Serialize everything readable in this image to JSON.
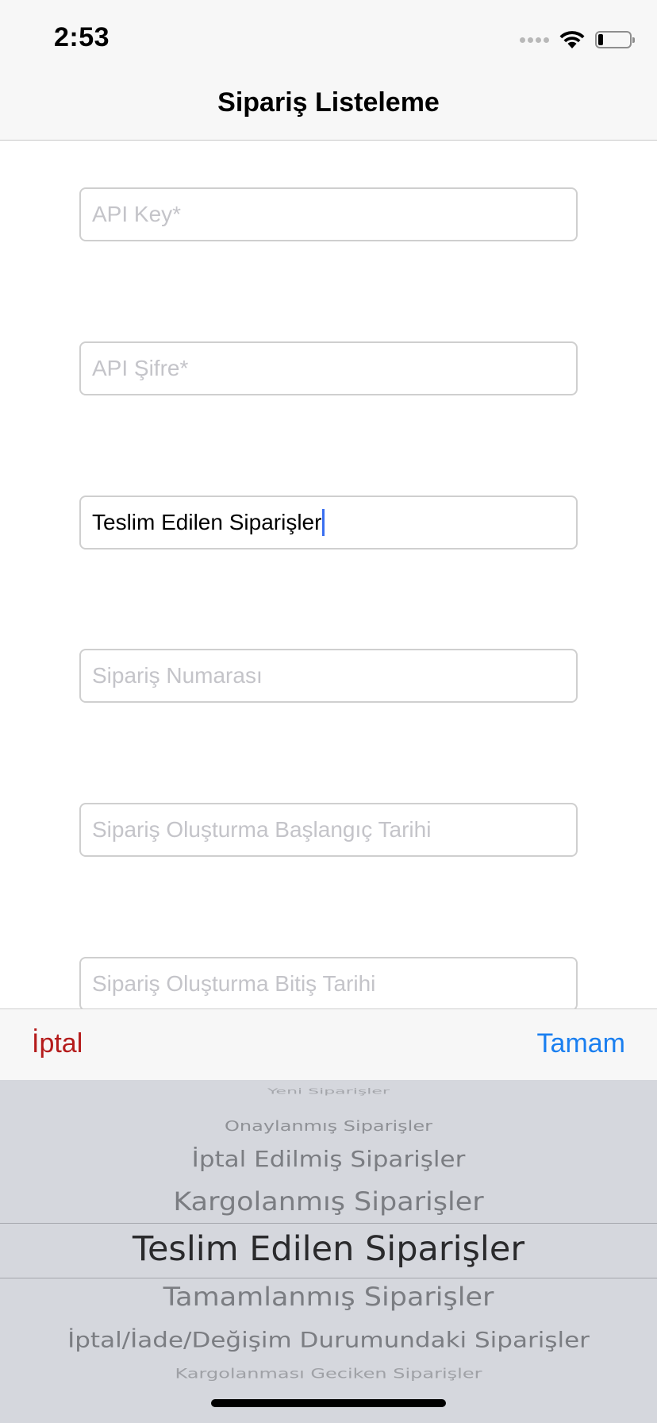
{
  "status_bar": {
    "time": "2:53",
    "icons": [
      "cellular-signal-icon",
      "wifi-icon",
      "battery-icon"
    ],
    "battery_level": 0.15
  },
  "nav_bar": {
    "title": "Sipariş Listeleme"
  },
  "form": {
    "api_key": {
      "placeholder": "API Key*",
      "value": ""
    },
    "api_password": {
      "placeholder": "API Şifre*",
      "value": ""
    },
    "order_status": {
      "placeholder": "",
      "value": "Teslim Edilen Siparişler"
    },
    "order_number": {
      "placeholder": "Sipariş Numarası",
      "value": ""
    },
    "start_date": {
      "placeholder": "Sipariş Oluşturma Başlangıç Tarihi",
      "value": ""
    },
    "end_date": {
      "placeholder": "Sipariş Oluşturma Bitiş Tarihi",
      "value": ""
    }
  },
  "picker_toolbar": {
    "cancel_label": "İptal",
    "done_label": "Tamam"
  },
  "picker": {
    "options": [
      "Yeni Siparişler",
      "Onaylanmış Siparişler",
      "İptal Edilmiş Siparişler",
      "Kargolanmış Siparişler",
      "Teslim Edilen Siparişler",
      "Tamamlanmış Siparişler",
      "İptal/İade/Değişim Durumundaki Siparişler",
      "Kargolanması Geciken Siparişler"
    ],
    "selected": "Teslim Edilen Siparişler"
  },
  "colors": {
    "cancel": "#b51c1c",
    "done": "#1a7ff0",
    "caret": "#3a6ff0",
    "picker_bg": "#d5d7dd"
  }
}
